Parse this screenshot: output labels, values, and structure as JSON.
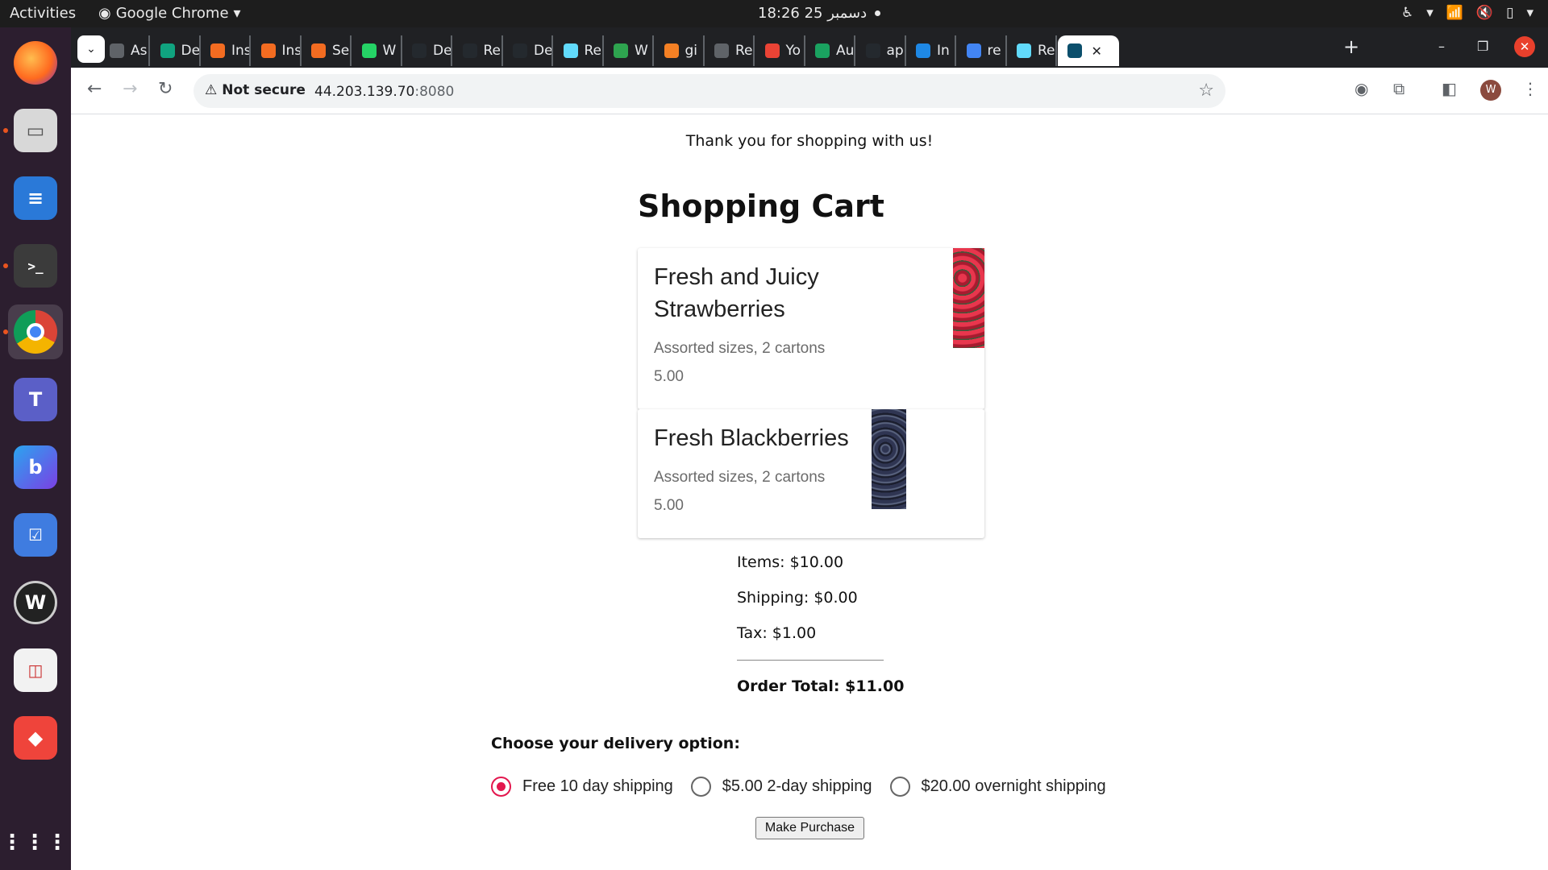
{
  "system": {
    "activities": "Activities",
    "app_name": "Google Chrome",
    "clock": "18:26  25 دسمبر"
  },
  "browser": {
    "tabs": [
      {
        "label": "As",
        "icon": "globe-icon",
        "color": "#5f6368"
      },
      {
        "label": "De",
        "icon": "chatgpt-icon",
        "color": "#10a37f"
      },
      {
        "label": "Ins",
        "icon": "orange-app-icon",
        "color": "#f36c21"
      },
      {
        "label": "Ins",
        "icon": "orange-app-icon",
        "color": "#f36c21"
      },
      {
        "label": "Se",
        "icon": "orange-app-icon",
        "color": "#f36c21"
      },
      {
        "label": "W",
        "icon": "whatsapp-icon",
        "color": "#25d366"
      },
      {
        "label": "De",
        "icon": "github-icon",
        "color": "#24292e"
      },
      {
        "label": "Re",
        "icon": "github-icon",
        "color": "#24292e"
      },
      {
        "label": "De",
        "icon": "github-icon",
        "color": "#24292e"
      },
      {
        "label": "Re",
        "icon": "react-icon",
        "color": "#61dafb"
      },
      {
        "label": "W",
        "icon": "github-icon",
        "color": "#2ea44f"
      },
      {
        "label": "gi",
        "icon": "stackoverflow-icon",
        "color": "#f48024"
      },
      {
        "label": "Re",
        "icon": "globe-icon",
        "color": "#5f6368"
      },
      {
        "label": "Yo",
        "icon": "gmail-icon",
        "color": "#ea4335"
      },
      {
        "label": "Au",
        "icon": "map-pin-icon",
        "color": "#1aa260"
      },
      {
        "label": "ap",
        "icon": "github-icon",
        "color": "#24292e"
      },
      {
        "label": "In",
        "icon": "edge-icon",
        "color": "#1e88e5"
      },
      {
        "label": "re",
        "icon": "google-icon",
        "color": "#4285f4"
      },
      {
        "label": "Re",
        "icon": "react-icon",
        "color": "#61dafb"
      }
    ],
    "address": {
      "security": "Not secure",
      "host": "44.203.139.70",
      "port": ":8080"
    },
    "profile_initial": "W"
  },
  "page": {
    "thanks": "Thank you for shopping with us!",
    "title": "Shopping Cart",
    "items": [
      {
        "name": "Fresh and Juicy Strawberries",
        "desc": "Assorted sizes, 2 cartons",
        "price": "5.00"
      },
      {
        "name": "Fresh Blackberries",
        "desc": "Assorted sizes, 2 cartons",
        "price": "5.00"
      }
    ],
    "summary": {
      "items": "Items: $10.00",
      "shipping": "Shipping: $0.00",
      "tax": "Tax: $1.00",
      "total": "Order Total: $11.00"
    },
    "delivery_heading": "Choose your delivery option:",
    "delivery_options": [
      {
        "label": "Free 10 day shipping",
        "checked": true
      },
      {
        "label": "$5.00 2-day shipping",
        "checked": false
      },
      {
        "label": "$20.00 overnight shipping",
        "checked": false
      }
    ],
    "purchase_button": "Make Purchase"
  }
}
